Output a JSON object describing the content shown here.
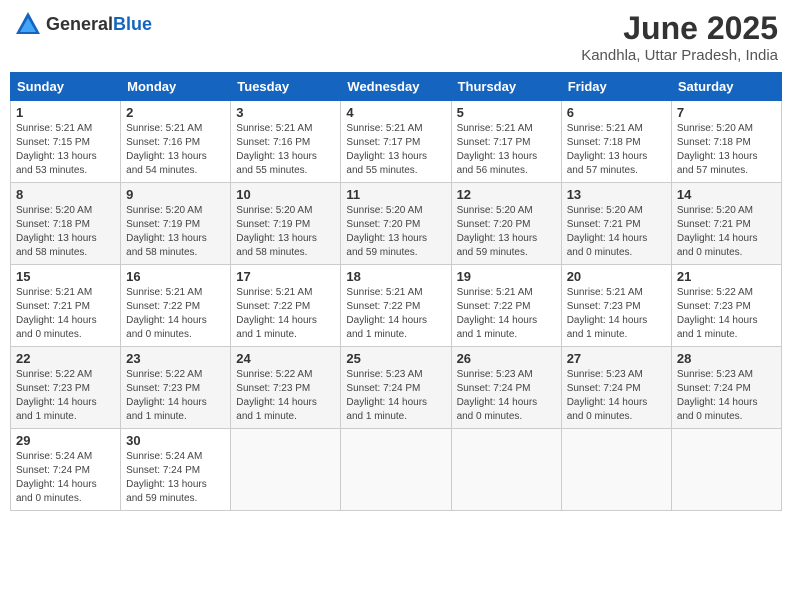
{
  "header": {
    "logo_general": "General",
    "logo_blue": "Blue",
    "month": "June 2025",
    "location": "Kandhla, Uttar Pradesh, India"
  },
  "days_of_week": [
    "Sunday",
    "Monday",
    "Tuesday",
    "Wednesday",
    "Thursday",
    "Friday",
    "Saturday"
  ],
  "weeks": [
    [
      {
        "day": "1",
        "info": "Sunrise: 5:21 AM\nSunset: 7:15 PM\nDaylight: 13 hours\nand 53 minutes."
      },
      {
        "day": "2",
        "info": "Sunrise: 5:21 AM\nSunset: 7:16 PM\nDaylight: 13 hours\nand 54 minutes."
      },
      {
        "day": "3",
        "info": "Sunrise: 5:21 AM\nSunset: 7:16 PM\nDaylight: 13 hours\nand 55 minutes."
      },
      {
        "day": "4",
        "info": "Sunrise: 5:21 AM\nSunset: 7:17 PM\nDaylight: 13 hours\nand 55 minutes."
      },
      {
        "day": "5",
        "info": "Sunrise: 5:21 AM\nSunset: 7:17 PM\nDaylight: 13 hours\nand 56 minutes."
      },
      {
        "day": "6",
        "info": "Sunrise: 5:21 AM\nSunset: 7:18 PM\nDaylight: 13 hours\nand 57 minutes."
      },
      {
        "day": "7",
        "info": "Sunrise: 5:20 AM\nSunset: 7:18 PM\nDaylight: 13 hours\nand 57 minutes."
      }
    ],
    [
      {
        "day": "8",
        "info": "Sunrise: 5:20 AM\nSunset: 7:18 PM\nDaylight: 13 hours\nand 58 minutes."
      },
      {
        "day": "9",
        "info": "Sunrise: 5:20 AM\nSunset: 7:19 PM\nDaylight: 13 hours\nand 58 minutes."
      },
      {
        "day": "10",
        "info": "Sunrise: 5:20 AM\nSunset: 7:19 PM\nDaylight: 13 hours\nand 58 minutes."
      },
      {
        "day": "11",
        "info": "Sunrise: 5:20 AM\nSunset: 7:20 PM\nDaylight: 13 hours\nand 59 minutes."
      },
      {
        "day": "12",
        "info": "Sunrise: 5:20 AM\nSunset: 7:20 PM\nDaylight: 13 hours\nand 59 minutes."
      },
      {
        "day": "13",
        "info": "Sunrise: 5:20 AM\nSunset: 7:21 PM\nDaylight: 14 hours\nand 0 minutes."
      },
      {
        "day": "14",
        "info": "Sunrise: 5:20 AM\nSunset: 7:21 PM\nDaylight: 14 hours\nand 0 minutes."
      }
    ],
    [
      {
        "day": "15",
        "info": "Sunrise: 5:21 AM\nSunset: 7:21 PM\nDaylight: 14 hours\nand 0 minutes."
      },
      {
        "day": "16",
        "info": "Sunrise: 5:21 AM\nSunset: 7:22 PM\nDaylight: 14 hours\nand 0 minutes."
      },
      {
        "day": "17",
        "info": "Sunrise: 5:21 AM\nSunset: 7:22 PM\nDaylight: 14 hours\nand 1 minute."
      },
      {
        "day": "18",
        "info": "Sunrise: 5:21 AM\nSunset: 7:22 PM\nDaylight: 14 hours\nand 1 minute."
      },
      {
        "day": "19",
        "info": "Sunrise: 5:21 AM\nSunset: 7:22 PM\nDaylight: 14 hours\nand 1 minute."
      },
      {
        "day": "20",
        "info": "Sunrise: 5:21 AM\nSunset: 7:23 PM\nDaylight: 14 hours\nand 1 minute."
      },
      {
        "day": "21",
        "info": "Sunrise: 5:22 AM\nSunset: 7:23 PM\nDaylight: 14 hours\nand 1 minute."
      }
    ],
    [
      {
        "day": "22",
        "info": "Sunrise: 5:22 AM\nSunset: 7:23 PM\nDaylight: 14 hours\nand 1 minute."
      },
      {
        "day": "23",
        "info": "Sunrise: 5:22 AM\nSunset: 7:23 PM\nDaylight: 14 hours\nand 1 minute."
      },
      {
        "day": "24",
        "info": "Sunrise: 5:22 AM\nSunset: 7:23 PM\nDaylight: 14 hours\nand 1 minute."
      },
      {
        "day": "25",
        "info": "Sunrise: 5:23 AM\nSunset: 7:24 PM\nDaylight: 14 hours\nand 1 minute."
      },
      {
        "day": "26",
        "info": "Sunrise: 5:23 AM\nSunset: 7:24 PM\nDaylight: 14 hours\nand 0 minutes."
      },
      {
        "day": "27",
        "info": "Sunrise: 5:23 AM\nSunset: 7:24 PM\nDaylight: 14 hours\nand 0 minutes."
      },
      {
        "day": "28",
        "info": "Sunrise: 5:23 AM\nSunset: 7:24 PM\nDaylight: 14 hours\nand 0 minutes."
      }
    ],
    [
      {
        "day": "29",
        "info": "Sunrise: 5:24 AM\nSunset: 7:24 PM\nDaylight: 14 hours\nand 0 minutes."
      },
      {
        "day": "30",
        "info": "Sunrise: 5:24 AM\nSunset: 7:24 PM\nDaylight: 13 hours\nand 59 minutes."
      },
      {
        "day": "",
        "info": ""
      },
      {
        "day": "",
        "info": ""
      },
      {
        "day": "",
        "info": ""
      },
      {
        "day": "",
        "info": ""
      },
      {
        "day": "",
        "info": ""
      }
    ]
  ]
}
